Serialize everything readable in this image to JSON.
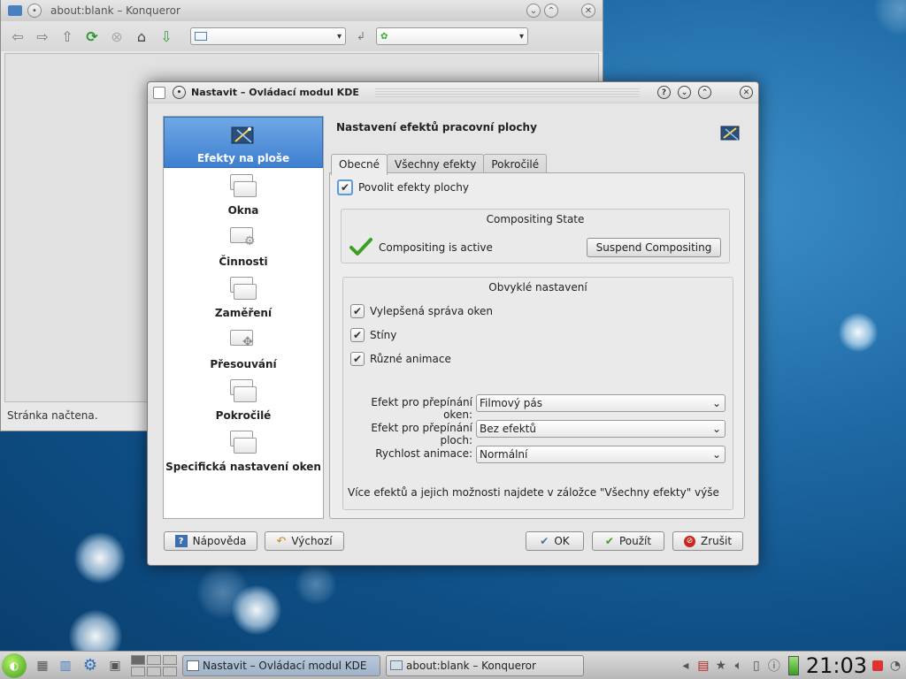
{
  "konqueror": {
    "title": "about:blank – Konqueror",
    "status": "Stránka načtena."
  },
  "dialog": {
    "title": "Nastavit – Ovládací modul KDE",
    "sidebar": {
      "items": [
        {
          "label": "Efekty na ploše",
          "active": true
        },
        {
          "label": "Okna"
        },
        {
          "label": "Činnosti"
        },
        {
          "label": "Zaměření"
        },
        {
          "label": "Přesouvání"
        },
        {
          "label": "Pokročilé"
        },
        {
          "label": "Specifická nastavení oken"
        }
      ]
    },
    "main": {
      "title": "Nastavení efektů pracovní plochy",
      "tabs": [
        "Obecné",
        "Všechny efekty",
        "Pokročilé"
      ],
      "enable_effects": "Povolit efekty plochy",
      "compositing_group": {
        "title": "Compositing State",
        "status": "Compositing is active",
        "button": "Suspend Compositing"
      },
      "common_group": {
        "title": "Obvyklé nastavení",
        "options": [
          "Vylepšená správa oken",
          "Stíny",
          "Různé animace"
        ],
        "switch_windows_label": "Efekt pro přepínání oken:",
        "switch_windows_value": "Filmový pás",
        "switch_desktops_label": "Efekt pro přepínání ploch:",
        "switch_desktops_value": "Bez efektů",
        "anim_speed_label": "Rychlost animace:",
        "anim_speed_value": "Normální",
        "hint": "Více efektů a jejich možnosti najdete v záložce \"Všechny efekty\" výše"
      }
    },
    "buttons": {
      "help": "Nápověda",
      "defaults": "Výchozí",
      "ok": "OK",
      "apply": "Použít",
      "cancel": "Zrušit"
    }
  },
  "taskbar": {
    "tasks": [
      "Nastavit – Ovládací modul KDE",
      "about:blank – Konqueror"
    ],
    "clock": "21:03"
  },
  "colors": {
    "selection": "#3e7fcf",
    "check_green": "#3aa020",
    "cancel_red": "#c8261e"
  }
}
